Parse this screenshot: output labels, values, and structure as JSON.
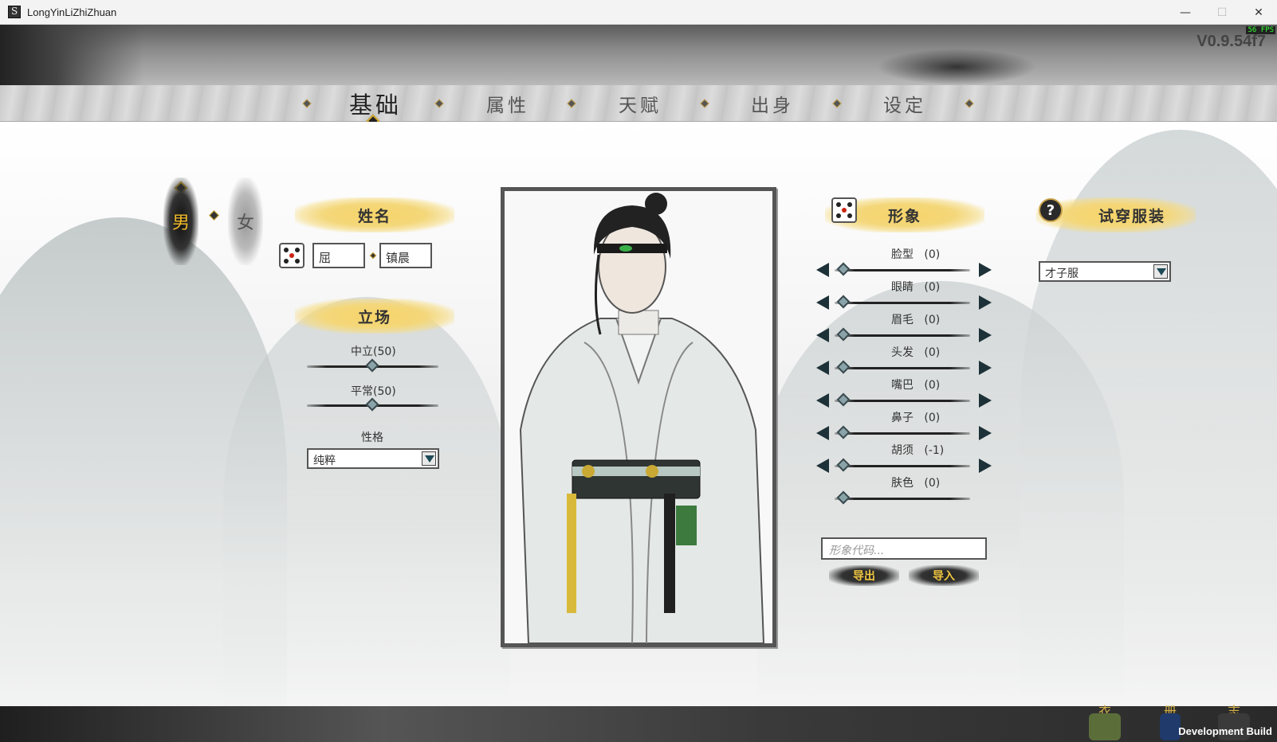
{
  "window": {
    "title": "LongYinLiZhiZhuan",
    "minimize": "—",
    "maximize": "☐",
    "close": "✕"
  },
  "hud": {
    "version": "V0.9.54f7",
    "fps": "56 FPS",
    "dev_build": "Development Build"
  },
  "tabs": [
    {
      "label": "基础",
      "active": true
    },
    {
      "label": "属性",
      "active": false
    },
    {
      "label": "天赋",
      "active": false
    },
    {
      "label": "出身",
      "active": false
    },
    {
      "label": "设定",
      "active": false
    }
  ],
  "gender": {
    "male": "男",
    "female": "女",
    "selected": "male"
  },
  "name_section": {
    "header": "姓名",
    "surname": "屈",
    "given_name": "镇晨"
  },
  "stance_section": {
    "header": "立场",
    "sliders": [
      {
        "label": "中立(50)",
        "value": 50,
        "max": 100
      },
      {
        "label": "平常(50)",
        "value": 50,
        "max": 100
      }
    ],
    "personality_label": "性格",
    "personality_value": "纯粹"
  },
  "appearance": {
    "header": "形象",
    "sliders": [
      {
        "label": "脸型",
        "value": "(0)",
        "has_arrows": true
      },
      {
        "label": "眼睛",
        "value": "(0)",
        "has_arrows": true
      },
      {
        "label": "眉毛",
        "value": "(0)",
        "has_arrows": true
      },
      {
        "label": "头发",
        "value": "(0)",
        "has_arrows": true
      },
      {
        "label": "嘴巴",
        "value": "(0)",
        "has_arrows": true
      },
      {
        "label": "鼻子",
        "value": "(0)",
        "has_arrows": true
      },
      {
        "label": "胡须",
        "value": "(-1)",
        "has_arrows": true
      },
      {
        "label": "肤色",
        "value": "(0)",
        "has_arrows": false
      }
    ],
    "code_placeholder": "形象代码...",
    "export_label": "导出",
    "import_label": "导入"
  },
  "outfit": {
    "header": "试穿服装",
    "help": "?",
    "selected": "才子服"
  },
  "bottom_icons": [
    {
      "label": "衣",
      "icon": "wardrobe-icon"
    },
    {
      "label": "册",
      "icon": "book-icon"
    },
    {
      "label": "志",
      "icon": "pavilion-icon"
    }
  ],
  "colors": {
    "accent_gold": "#f0b92a",
    "ink_dark": "#1d3238",
    "brush_yellow": "#f6d469"
  }
}
